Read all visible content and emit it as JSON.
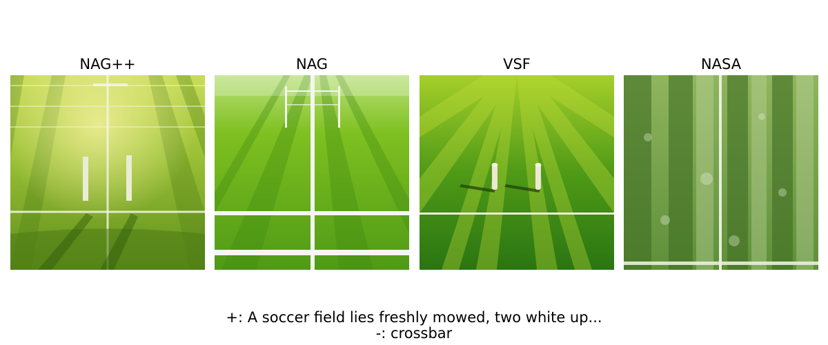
{
  "panels": [
    {
      "title": "NAG++"
    },
    {
      "title": "NAG"
    },
    {
      "title": "VSF"
    },
    {
      "title": "NASA"
    }
  ],
  "caption": {
    "positive": "+: A soccer field lies freshly mowed, two white up...",
    "negative": "-: crossbar"
  },
  "colors": {
    "background": "#ffffff",
    "grass_light": "#a8d34a",
    "grass_mid": "#6fae1e",
    "grass_dark": "#2f7a12",
    "line_white": "#f2f4ec"
  }
}
